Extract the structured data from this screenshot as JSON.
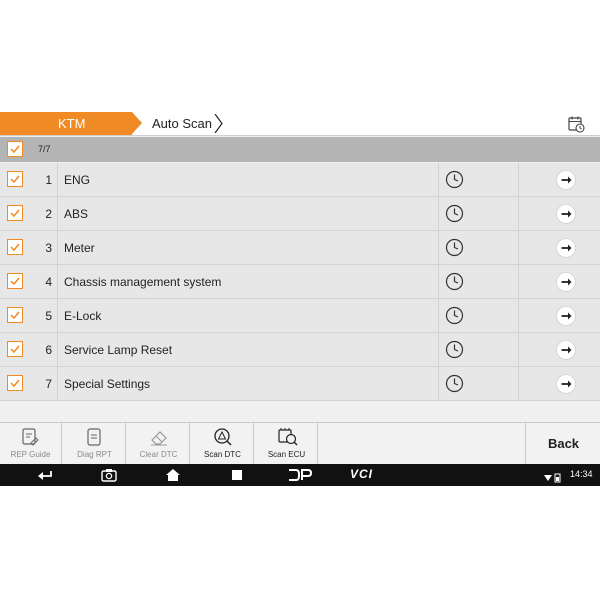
{
  "header": {
    "breadcrumb": [
      "KTM",
      "Auto Scan"
    ],
    "report_icon": "calendar-clock-icon"
  },
  "select_all": {
    "checked": true,
    "count": "7/7"
  },
  "rows": [
    {
      "num": "1",
      "name": "ENG",
      "checked": true
    },
    {
      "num": "2",
      "name": "ABS",
      "checked": true
    },
    {
      "num": "3",
      "name": "Meter",
      "checked": true
    },
    {
      "num": "4",
      "name": "Chassis management system",
      "checked": true
    },
    {
      "num": "5",
      "name": "E-Lock",
      "checked": true
    },
    {
      "num": "6",
      "name": "Service Lamp Reset",
      "checked": true
    },
    {
      "num": "7",
      "name": "Special Settings",
      "checked": true
    }
  ],
  "toolbar": {
    "rep_guide": "REP Guide",
    "diag_rpt": "Diag RPT",
    "clear_dtc": "Clear DTC",
    "scan_dtc": "Scan DTC",
    "scan_ecu": "Scan ECU",
    "back": "Back"
  },
  "navbar": {
    "logo": "VCI",
    "time": "14:34"
  },
  "colors": {
    "accent": "#f08a24",
    "select_bar": "#b4b4b4",
    "row_bg": "#e7e7e7"
  }
}
